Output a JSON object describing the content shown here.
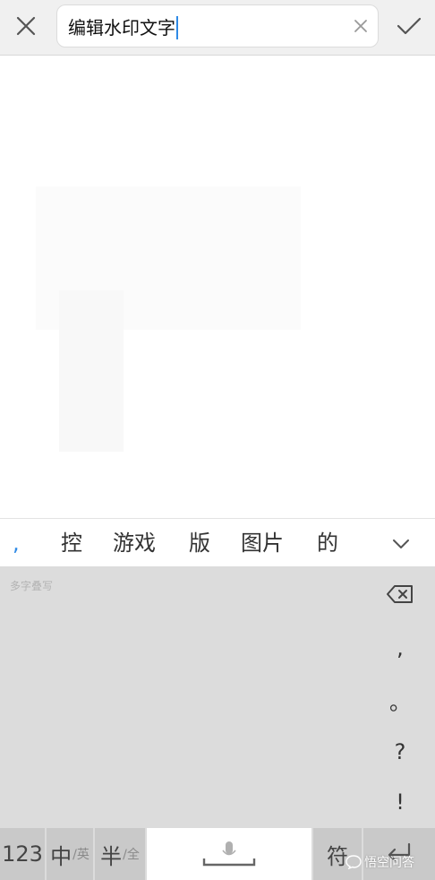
{
  "editor": {
    "text": "编辑水印文字"
  },
  "candidates": [
    ",",
    "控",
    "游戏",
    "版",
    "图片",
    "的"
  ],
  "keyboard": {
    "handwriting_hint": "多字叠写",
    "side_keys": [
      ",",
      "。",
      "?",
      "!"
    ],
    "bottom": {
      "num_label": "123",
      "cn_label": "中",
      "cn_sub": "/英",
      "half_label": "半",
      "half_sub": "/全",
      "symbol_label": "符"
    }
  },
  "watermark": {
    "text": "悟空问答"
  },
  "colors": {
    "accent": "#2f8ae6",
    "keyboard_bg": "#dcdcdc",
    "key_bg": "#c9c9c9"
  }
}
